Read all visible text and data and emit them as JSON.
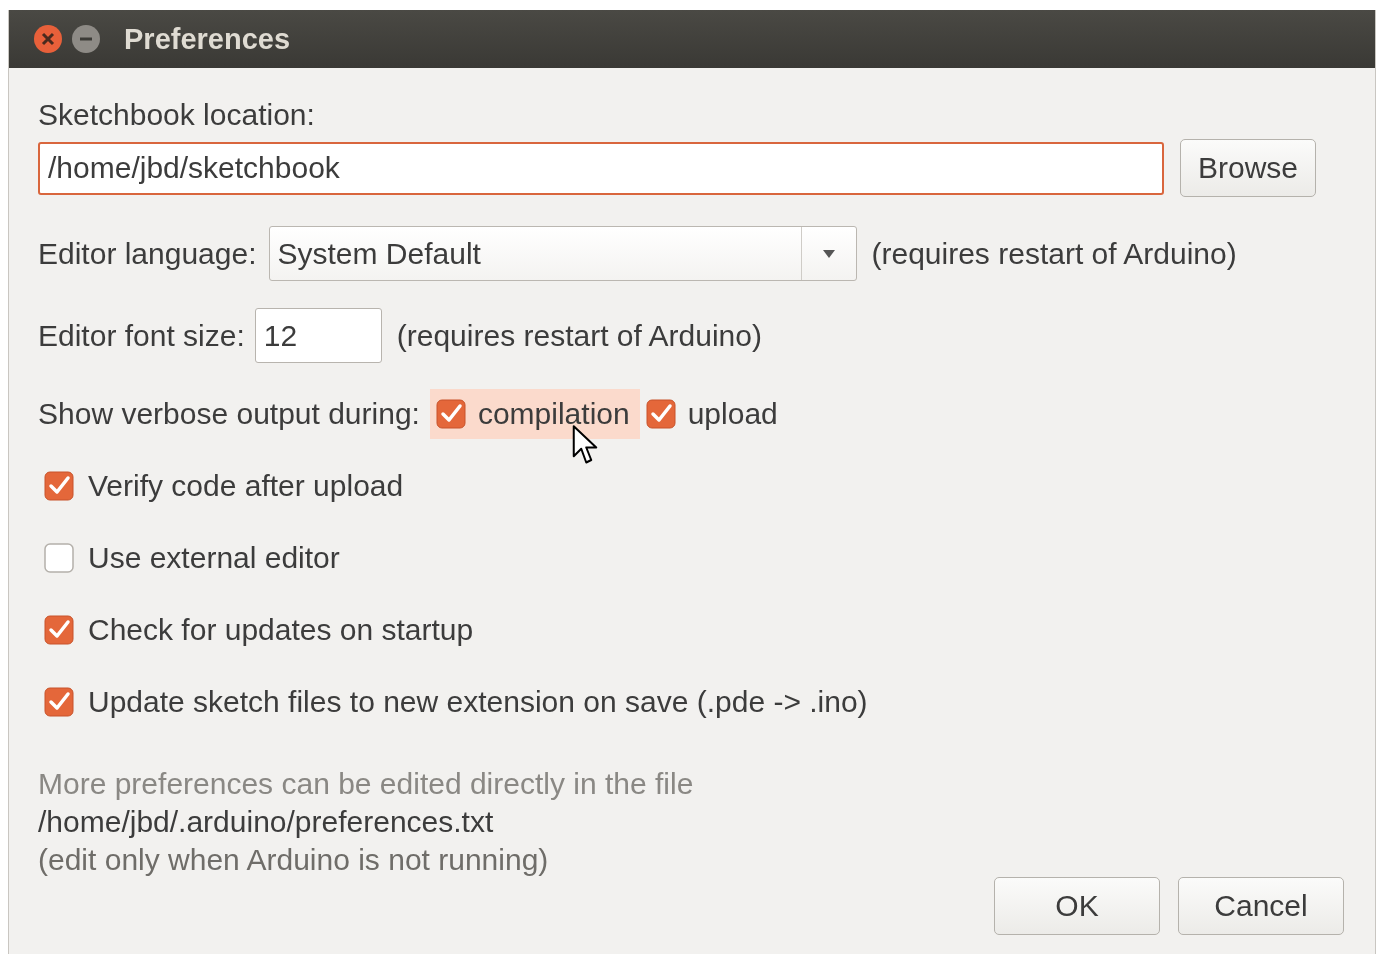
{
  "window": {
    "title": "Preferences"
  },
  "sketchbook": {
    "label": "Sketchbook location:",
    "value": "/home/jbd/sketchbook",
    "focused": true,
    "browse_button": "Browse"
  },
  "editor_language": {
    "label": "Editor language:",
    "value": "System Default",
    "note": "(requires restart of Arduino)"
  },
  "font_size": {
    "label": "Editor font size:",
    "value": "12",
    "note": "(requires restart of Arduino)"
  },
  "verbose": {
    "label": "Show verbose output during:",
    "options": [
      {
        "label": "compilation",
        "checked": true,
        "hovered": true
      },
      {
        "label": "upload",
        "checked": true,
        "hovered": false
      }
    ]
  },
  "options": [
    {
      "label": "Verify code after upload",
      "checked": true
    },
    {
      "label": "Use external editor",
      "checked": false
    },
    {
      "label": "Check for updates on startup",
      "checked": true
    },
    {
      "label": "Update sketch files to new extension on save (.pde -> .ino)",
      "checked": true
    }
  ],
  "info": [
    "More preferences can be edited directly in the file",
    "/home/jbd/.arduino/preferences.txt",
    "(edit only when Arduino is not running)"
  ],
  "buttons": [
    "OK",
    "Cancel"
  ]
}
